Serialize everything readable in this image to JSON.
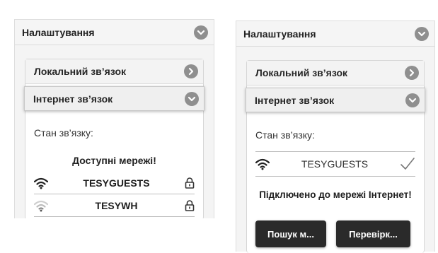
{
  "left": {
    "settings_title": "Налаштування",
    "local_title": "Локальний зв’язок",
    "internet_title": "Інтернет зв’язок",
    "status_label": "Стан зв’язку:",
    "available_networks": "Доступні мережі!",
    "networks": [
      {
        "ssid": "TESYGUESTS",
        "signal": "strong",
        "locked": true
      },
      {
        "ssid": "TESYWH",
        "signal": "weak",
        "locked": true
      }
    ]
  },
  "right": {
    "settings_title": "Налаштування",
    "local_title": "Локальний зв’язок",
    "internet_title": "Інтернет зв’язок",
    "status_label": "Стан зв’язку:",
    "connected_network": {
      "ssid": "TESYGUESTS",
      "signal": "strong",
      "checked": true
    },
    "connected_message": "Підключено до мережі Інтернет!",
    "search_button": "Пошук м...",
    "check_button": "Перевірк..."
  },
  "colors": {
    "panel_bg": "#f4f4f4",
    "circle_icon": "#8f8f8f",
    "button_bg": "#2a2a2a"
  },
  "icons": {
    "expand": "chevron-down-icon",
    "collapsed": "chevron-right-icon",
    "wifi": "wifi-icon",
    "lock": "lock-icon",
    "check": "check-icon"
  }
}
